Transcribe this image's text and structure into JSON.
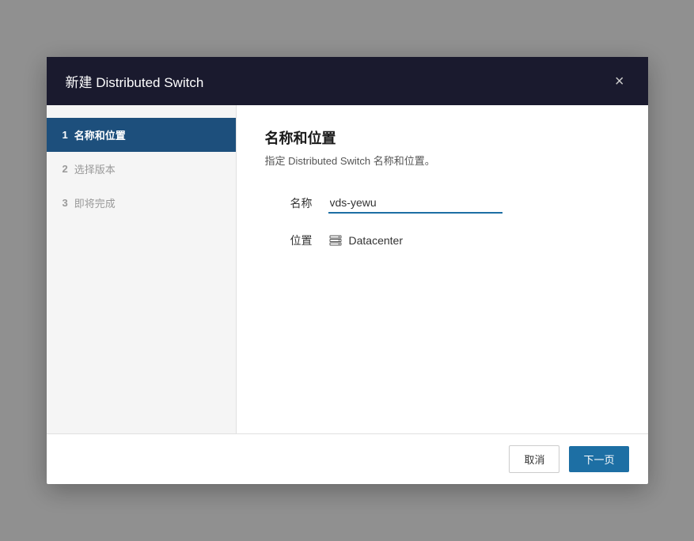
{
  "dialog": {
    "title": "新建 Distributed Switch",
    "close_label": "×"
  },
  "sidebar": {
    "steps": [
      {
        "number": "1",
        "label": "名称和位置",
        "active": true
      },
      {
        "number": "2",
        "label": "选择版本",
        "active": false
      },
      {
        "number": "3",
        "label": "即将完成",
        "active": false
      }
    ]
  },
  "content": {
    "title": "名称和位置",
    "subtitle": "指定 Distributed Switch 名称和位置。",
    "name_label": "名称",
    "name_value": "vds-yewu",
    "location_label": "位置",
    "location_value": "Datacenter",
    "location_icon": "datacenter"
  },
  "footer": {
    "cancel_label": "取消",
    "next_label": "下一页"
  }
}
